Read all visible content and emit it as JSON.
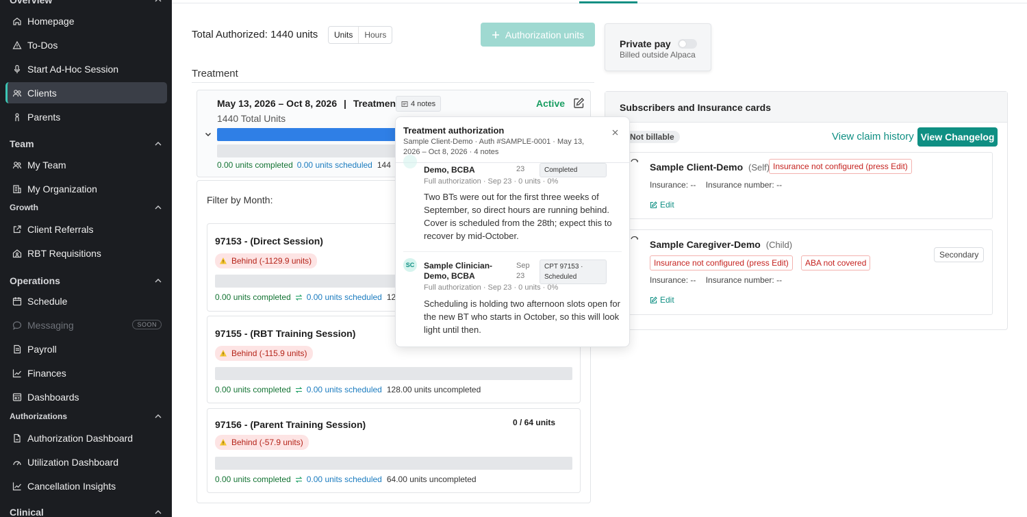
{
  "sidebar": {
    "sections": {
      "overview": "Overview",
      "team": "Team",
      "growth": "Growth",
      "operations": "Operations",
      "authorizations": "Authorizations",
      "clinical": "Clinical"
    },
    "items": {
      "homepage": "Homepage",
      "todos": "To-Dos",
      "adhoc": "Start Ad-Hoc Session",
      "clients": "Clients",
      "parents": "Parents",
      "my_team": "My Team",
      "my_org": "My Organization",
      "referrals": "Client Referrals",
      "rbt": "RBT Requisitions",
      "schedule": "Schedule",
      "messaging": "Messaging",
      "messaging_badge": "SOON",
      "payroll": "Payroll",
      "finances": "Finances",
      "dashboards": "Dashboards",
      "auth_dashboard": "Authorization Dashboard",
      "util_dashboard": "Utilization Dashboard",
      "cancel_insights": "Cancellation Insights"
    }
  },
  "main": {
    "total_authorized": "Total Authorized: 1440 units",
    "toggle": {
      "units": "Units",
      "hours": "Hours"
    },
    "auth_units_button": "Authorization units",
    "treatment_heading": "Treatment",
    "auth": {
      "date_range": "May 13, 2026 – Oct 8, 2026",
      "separator": "|",
      "type": "Treatment",
      "notes_chip": "4 notes",
      "status": "Active",
      "total_units": "1440 Total Units",
      "completed": "0.00 units completed",
      "scheduled": "0.00 units scheduled",
      "remaining_partial": "144"
    },
    "filter_label": "Filter by Month:",
    "codes": [
      {
        "title": "97153 - (Direct Session)",
        "behind": "Behind (-1129.9 units)",
        "completed": "0.00 units completed",
        "scheduled": "0.00 units scheduled",
        "uncompleted": "12",
        "quota": ""
      },
      {
        "title": "97155 - (RBT Training Session)",
        "behind": "Behind (-115.9 units)",
        "completed": "0.00 units completed",
        "scheduled": "0.00 units scheduled",
        "uncompleted": "128.00 units uncompleted",
        "quota": ""
      },
      {
        "title": "97156 - (Parent Training Session)",
        "behind": "Behind (-57.9 units)",
        "completed": "0.00 units completed",
        "scheduled": "0.00 units scheduled",
        "uncompleted": "64.00 units uncompleted",
        "quota": "0 / 64 units"
      }
    ]
  },
  "popup": {
    "title": "Treatment authorization",
    "subtitle": "Sample Client-Demo · Auth #SAMPLE-0001 · May 13, 2026 – Oct 8, 2026 · 4 notes",
    "notes": [
      {
        "author": "Demo, BCBA",
        "date": "23",
        "chip": "Completed",
        "meta": "Full authorization · Sep 23 · 0 units · 0%",
        "text": "Two BTs were out for the first three weeks of September, so direct hours are running behind. Cover is scheduled from the 28th; expect this to recover by mid-October."
      },
      {
        "initials": "SC",
        "author_line1": "Sample Clinician-",
        "author_line2": "Demo, BCBA",
        "date_line1": "Sep",
        "date_line2": "23",
        "chip_line1": "CPT 97153 ·",
        "chip_line2": "Scheduled",
        "meta": "Full authorization · Sep 23 · 0 units · 0%",
        "text": "Scheduling is holding two afternoon slots open for the new BT who starts in October, so this will look light until then."
      }
    ]
  },
  "right": {
    "private_pay": {
      "title": "Private pay",
      "subtitle": "Billed outside Alpaca"
    },
    "subscribers_title": "Subscribers and Insurance cards",
    "not_billable": "Not billable",
    "view_claim_history": "View claim history",
    "view_changelog": "View Changelog",
    "subscribers": [
      {
        "name": "Sample Client-Demo",
        "relation": "(Self)",
        "tags": [
          "Insurance not configured (press Edit)"
        ],
        "insurance": "Insurance: --",
        "insurance_number": "Insurance number: --",
        "edit": "Edit",
        "badge": ""
      },
      {
        "name": "Sample Caregiver-Demo",
        "relation": "(Child)",
        "tags": [
          "Insurance not configured (press Edit)",
          "ABA not covered"
        ],
        "insurance": "Insurance: --",
        "insurance_number": "Insurance number: --",
        "edit": "Edit",
        "badge": "Secondary"
      }
    ]
  },
  "colors": {
    "accent": "#0f8f83",
    "active_green": "#1a9e62",
    "bar_blue": "#2f7fe6",
    "danger": "#c5221f"
  }
}
